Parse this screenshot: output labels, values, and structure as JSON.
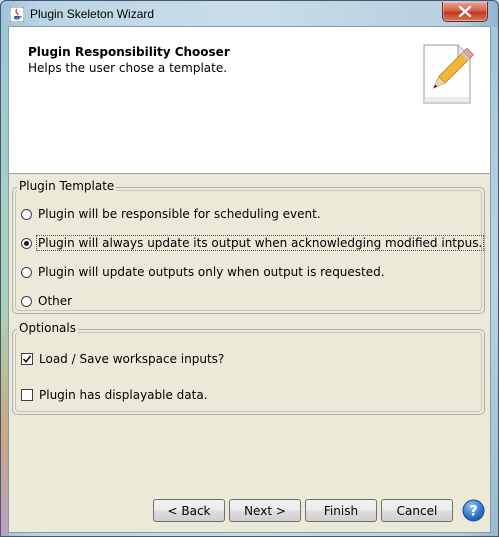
{
  "window": {
    "title": "Plugin Skeleton Wizard"
  },
  "header": {
    "title": "Plugin Responsibility Chooser",
    "subtitle": "Helps the user chose a template.",
    "icon": "pencil-paper-icon"
  },
  "template_section": {
    "legend": "Plugin Template",
    "options": [
      {
        "label": "Plugin will be responsible for scheduling event.",
        "selected": false
      },
      {
        "label": "Plugin will always update its output when acknowledging modified intpus.",
        "selected": true
      },
      {
        "label": "Plugin will update outputs only when output is requested.",
        "selected": false
      },
      {
        "label": "Other",
        "selected": false
      }
    ]
  },
  "optionals_section": {
    "legend": "Optionals",
    "options": [
      {
        "label": "Load / Save workspace inputs?",
        "checked": true
      },
      {
        "label": "Plugin has displayable data.",
        "checked": false
      }
    ]
  },
  "buttons": {
    "back": "< Back",
    "next": "Next >",
    "finish": "Finish",
    "cancel": "Cancel",
    "help_icon": "help-icon"
  },
  "colors": {
    "dialog_bg": "#ece9d8",
    "header_bg": "#ffffff",
    "close_button": "#c2351d",
    "help_button": "#3d7fd1"
  }
}
